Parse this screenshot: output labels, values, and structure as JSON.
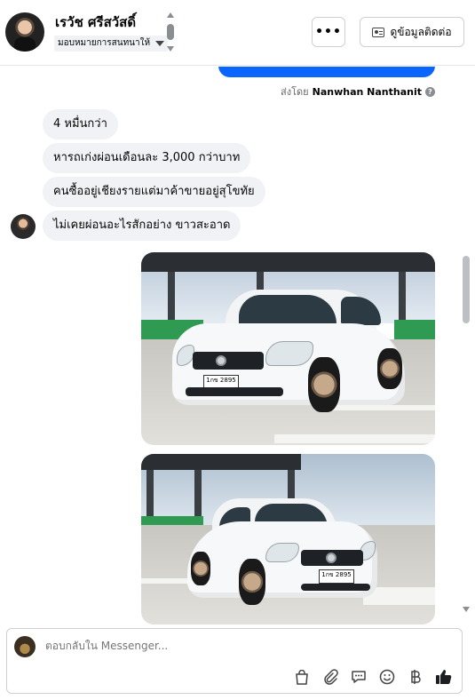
{
  "header": {
    "contact_name": "เรวัช ศรีสวัสดิ์",
    "assign_label": "มอบหมายการสนทนาให้",
    "more_button": "•••",
    "contact_info_button": "ดูข้อมูลติดต่อ"
  },
  "conversation": {
    "sent_by_prefix": "ส่งโดย",
    "sent_by_name": "Nanwhan Nanthanit",
    "info_symbol": "?",
    "messages": [
      {
        "text": "4 หมื่นกว่า"
      },
      {
        "text": "หารถเก่งผ่อนเดือนละ 3,000 กว่าบาท"
      },
      {
        "text": "คนซื้ออยู่เชียงรายแต่มาค้าขายอยู่สุโขทัย"
      },
      {
        "text": "ไม่เคยผ่อนอะไรสักอย่าง ขาวสะอาด"
      }
    ],
    "photos": [
      {
        "plate": "1กข 2895",
        "subject": "white sedan car"
      },
      {
        "plate": "1กข 2895",
        "subject": "white sedan car"
      }
    ]
  },
  "composer": {
    "placeholder": "ตอบกลับใน Messenger...",
    "tools": [
      "shopping-bag-icon",
      "paperclip-icon",
      "saved-reply-icon",
      "emoji-icon",
      "baht-icon",
      "thumbs-up-icon"
    ]
  },
  "colors": {
    "accent": "#0866ff",
    "bubble": "#f0f2f5",
    "secondary_text": "#65676b"
  }
}
